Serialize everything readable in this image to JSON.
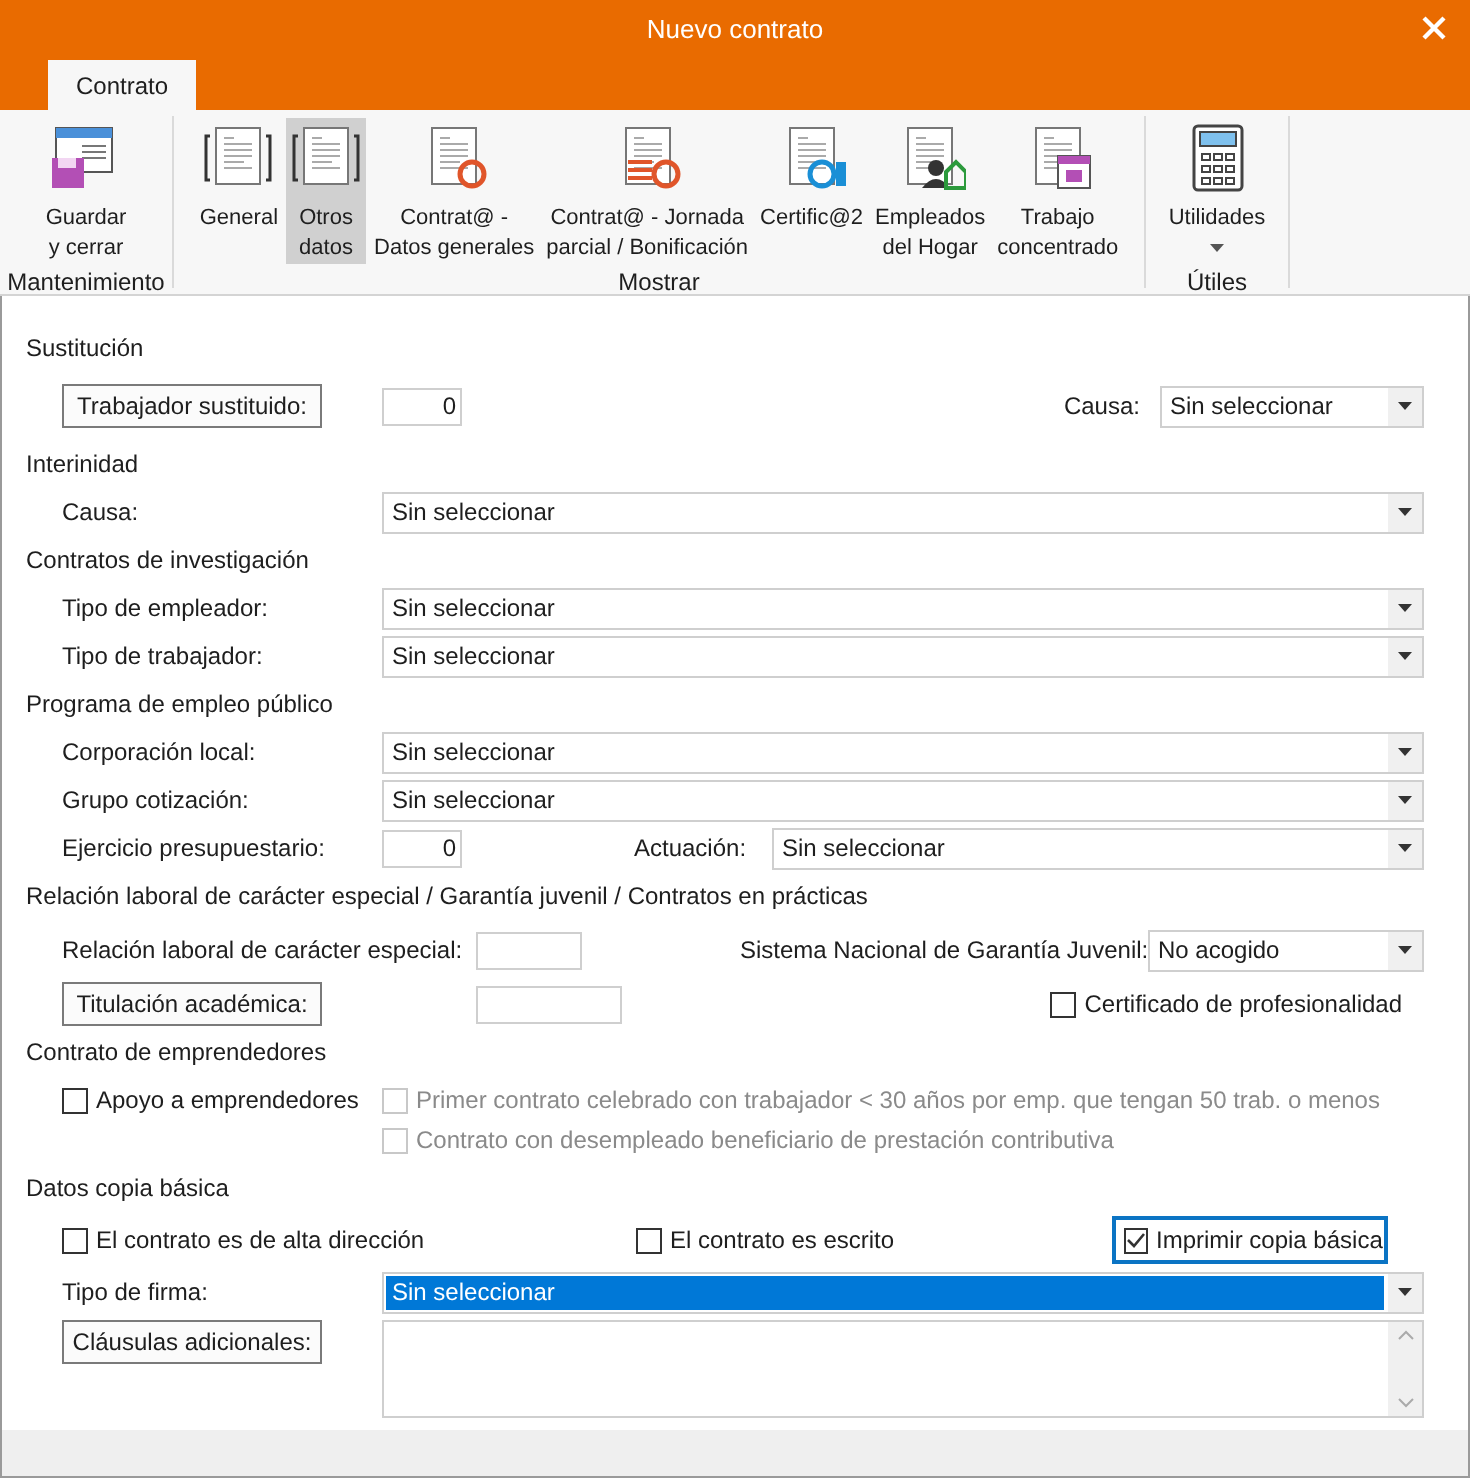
{
  "window": {
    "title": "Nuevo contrato"
  },
  "tabs": [
    {
      "label": "Contrato",
      "selected": true
    }
  ],
  "ribbon": {
    "groups": [
      {
        "label": "Mantenimiento",
        "buttons": [
          {
            "kind": "save",
            "lines": [
              "Guardar",
              "y cerrar"
            ],
            "selected": false
          }
        ]
      },
      {
        "label": "Mostrar",
        "buttons": [
          {
            "kind": "form",
            "lines": [
              "General"
            ],
            "selected": false
          },
          {
            "kind": "form",
            "lines": [
              "Otros",
              "datos"
            ],
            "selected": true
          },
          {
            "kind": "contrata",
            "lines": [
              "Contrat@ -",
              "Datos generales"
            ],
            "selected": false
          },
          {
            "kind": "contrata_lines",
            "lines": [
              "Contrat@ - Jornada",
              "parcial / Bonificación"
            ],
            "selected": false
          },
          {
            "kind": "certifica",
            "lines": [
              "Certific@2"
            ],
            "selected": false
          },
          {
            "kind": "home",
            "lines": [
              "Empleados",
              "del Hogar"
            ],
            "selected": false
          },
          {
            "kind": "calendar",
            "lines": [
              "Trabajo",
              "concentrado"
            ],
            "selected": false
          }
        ]
      },
      {
        "label": "Útiles",
        "buttons": [
          {
            "kind": "calculator",
            "lines": [
              "Utilidades"
            ],
            "selected": false,
            "dropdown": true
          }
        ]
      }
    ]
  },
  "form": {
    "sections": [
      {
        "title": "Sustitución",
        "rows": [
          [
            {
              "kind": "button",
              "label": "Trabajador sustituido:"
            },
            {
              "kind": "input",
              "value": "0"
            },
            {
              "kind": "label",
              "text": "Causa:"
            },
            {
              "kind": "select",
              "value": "Sin seleccionar",
              "highlighted": false
            }
          ]
        ]
      },
      {
        "title": "Interinidad",
        "rows": [
          [
            {
              "kind": "label",
              "text": "Causa:"
            },
            {
              "kind": "select",
              "value": "Sin seleccionar",
              "highlighted": false
            }
          ]
        ]
      },
      {
        "title": "Contratos de investigación",
        "rows": [
          [
            {
              "kind": "label",
              "text": "Tipo de empleador:"
            },
            {
              "kind": "select",
              "value": "Sin seleccionar",
              "highlighted": false
            }
          ],
          [
            {
              "kind": "label",
              "text": "Tipo de trabajador:"
            },
            {
              "kind": "select",
              "value": "Sin seleccionar",
              "highlighted": false
            }
          ]
        ]
      },
      {
        "title": "Programa de empleo público",
        "rows": [
          [
            {
              "kind": "label",
              "text": "Corporación local:"
            },
            {
              "kind": "select",
              "value": "Sin seleccionar",
              "highlighted": false
            }
          ],
          [
            {
              "kind": "label",
              "text": "Grupo cotización:"
            },
            {
              "kind": "select",
              "value": "Sin seleccionar",
              "highlighted": false
            }
          ],
          [
            {
              "kind": "label",
              "text": "Ejercicio presupuestario:"
            },
            {
              "kind": "input",
              "value": "0"
            },
            {
              "kind": "label",
              "text": "Actuación:"
            },
            {
              "kind": "select",
              "value": "Sin seleccionar",
              "highlighted": false
            }
          ]
        ]
      },
      {
        "title": "Relación laboral de carácter especial / Garantía juvenil / Contratos en prácticas",
        "rows": [
          [
            {
              "kind": "label",
              "text": "Relación laboral de carácter especial:"
            },
            {
              "kind": "input"
            },
            {
              "kind": "label",
              "text": "Sistema Nacional de Garantía Juvenil:"
            },
            {
              "kind": "select",
              "value": "No acogido",
              "highlighted": false
            }
          ],
          [
            {
              "kind": "button",
              "label": "Titulación académica:"
            },
            {
              "kind": "input"
            },
            {
              "kind": "checkbox",
              "label": "Certificado de profesionalidad",
              "checked": false,
              "disabled": false,
              "focused": false
            }
          ]
        ]
      },
      {
        "title": "Contrato de emprendedores",
        "rows": [
          [
            {
              "kind": "checkbox",
              "label": "Apoyo a emprendedores",
              "checked": false,
              "disabled": false,
              "focused": false
            },
            {
              "kind": "checkbox_group",
              "items": [
                {
                  "kind": "checkbox",
                  "label": "Primer contrato celebrado con trabajador < 30 años por emp. que tengan 50 trab. o menos",
                  "checked": false,
                  "disabled": true,
                  "focused": false
                },
                {
                  "kind": "checkbox",
                  "label": "Contrato con desempleado beneficiario de prestación contributiva",
                  "checked": false,
                  "disabled": true,
                  "focused": false
                }
              ]
            }
          ]
        ]
      },
      {
        "title": "Datos copia básica",
        "rows": [
          [
            {
              "kind": "checkbox",
              "label": "El contrato es de alta dirección",
              "checked": false,
              "disabled": false,
              "focused": false
            },
            {
              "kind": "checkbox",
              "label": "El contrato es escrito",
              "checked": false,
              "disabled": false,
              "focused": false
            },
            {
              "kind": "checkbox",
              "label": "Imprimir copia básica",
              "checked": true,
              "disabled": false,
              "focused": true
            }
          ],
          [
            {
              "kind": "label",
              "text": "Tipo de firma:"
            },
            {
              "kind": "select",
              "value": "Sin seleccionar",
              "highlighted": true
            }
          ],
          [
            {
              "kind": "button",
              "label": "Cláusulas adicionales:"
            },
            {
              "kind": "textarea"
            }
          ]
        ]
      }
    ]
  }
}
